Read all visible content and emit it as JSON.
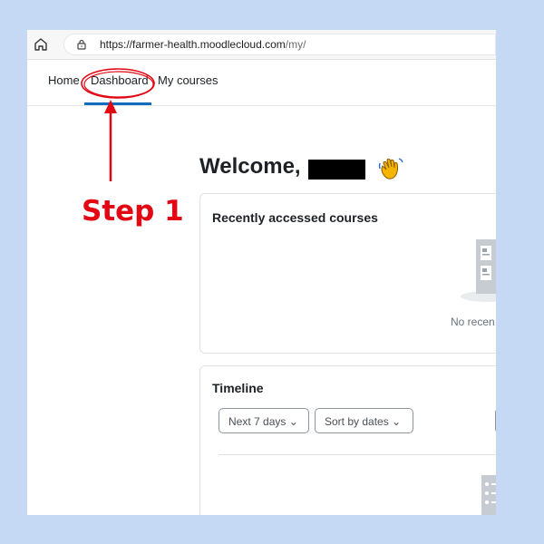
{
  "browser": {
    "url_host": "https://farmer-health.moodlecloud.com",
    "url_path": "/my/"
  },
  "nav": {
    "items": [
      {
        "label": "Home"
      },
      {
        "label": "Dashboard"
      },
      {
        "label": "My courses"
      }
    ],
    "active": "Dashboard"
  },
  "page": {
    "welcome_prefix": "Welcome,",
    "wave_icon": "waving-hand-emoji"
  },
  "recent_courses": {
    "title": "Recently accessed courses",
    "empty_text": "No recen"
  },
  "timeline": {
    "title": "Timeline",
    "range_select": "Next 7 days",
    "sort_select": "Sort by dates"
  },
  "annotation": {
    "step_label": "Step 1",
    "color": "#e30613"
  },
  "colors": {
    "accent": "#0f6cbf",
    "background": "#c5d8f4"
  }
}
